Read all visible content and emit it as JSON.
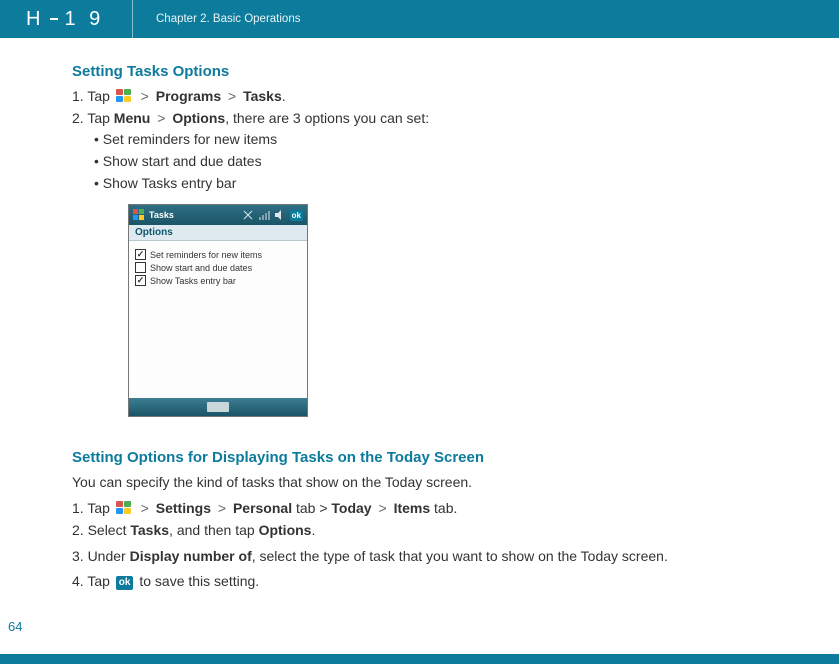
{
  "header": {
    "logo": "H-19",
    "chapter": "Chapter 2. Basic Operations"
  },
  "section1": {
    "title": "Setting Tasks Options",
    "step1_pre": "1. Tap ",
    "step1_seg_programs": "Programs",
    "step1_seg_tasks": "Tasks",
    "step1_end": ".",
    "step2_pre": "2. Tap ",
    "step2_seg_menu": "Menu",
    "step2_seg_options": "Options",
    "step2_post": ", there are 3 options you can set:",
    "bullets": {
      "b1": "Set reminders for new items",
      "b2": "Show start and due dates",
      "b3": "Show Tasks entry bar"
    }
  },
  "screenshot": {
    "title": "Tasks",
    "ok": "ok",
    "subtitle": "Options",
    "row1": {
      "checked": true,
      "label": "Set reminders for new items"
    },
    "row2": {
      "checked": false,
      "label": "Show start and due dates"
    },
    "row3": {
      "checked": true,
      "label": "Show Tasks entry bar"
    }
  },
  "section2": {
    "title": "Setting Options for Displaying Tasks on the Today Screen",
    "intro": "You can specify the kind of tasks that show on the Today screen.",
    "s1_pre": "1. Tap ",
    "s1_settings": "Settings",
    "s1_personal": "Personal",
    "s1_tab1": " tab > ",
    "s1_today": "Today",
    "s1_items": "Items",
    "s1_tab2": " tab.",
    "s2_pre": "2. Select ",
    "s2_tasks": "Tasks",
    "s2_mid": ", and then tap ",
    "s2_options": "Options",
    "s2_end": ".",
    "s3_pre": "3. Under ",
    "s3_bold": "Display number of",
    "s3_post": ", select the type of task that you want to show on the Today screen.",
    "s4_pre": "4. Tap ",
    "s4_post": " to save this setting.",
    "ok_label": "ok"
  },
  "page_number": "64",
  "gt": ">"
}
